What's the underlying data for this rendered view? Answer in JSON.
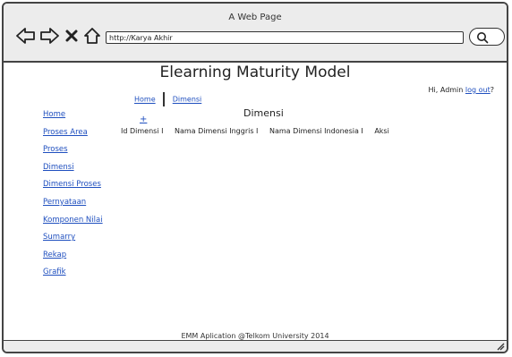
{
  "window": {
    "title": "A Web Page",
    "url": "http://Karya Akhir"
  },
  "icons": {
    "back": "back-arrow-icon",
    "forward": "forward-arrow-icon",
    "close": "close-icon",
    "home": "home-icon",
    "search": "search-icon"
  },
  "header": {
    "title": "Elearning Maturity Model",
    "greeting": "Hi, Admin",
    "logout_label": "log out",
    "logout_suffix": "?"
  },
  "breadcrumb": {
    "home": "Home",
    "current": "Dimensi"
  },
  "sidebar": {
    "items": [
      {
        "label": "Home"
      },
      {
        "label": "Proses Area"
      },
      {
        "label": "Proses"
      },
      {
        "label": "Dimensi"
      },
      {
        "label": "Dimensi Proses"
      },
      {
        "label": "Pernyataan"
      },
      {
        "label": "Komponen Nilai"
      },
      {
        "label": "Sumarry"
      },
      {
        "label": "Rekap"
      },
      {
        "label": "Grafik"
      }
    ]
  },
  "main": {
    "section_title": "Dimensi",
    "add_label": "+",
    "columns": [
      "Id Dimensi I",
      "Nama Dimensi Inggris I",
      "Nama Dimensi Indonesia I",
      "Aksi"
    ]
  },
  "footer": {
    "text": "EMM Aplication @Telkom University 2014"
  },
  "colors": {
    "link": "#1f4fbf",
    "chrome": "#ececec",
    "outline": "#444444"
  }
}
